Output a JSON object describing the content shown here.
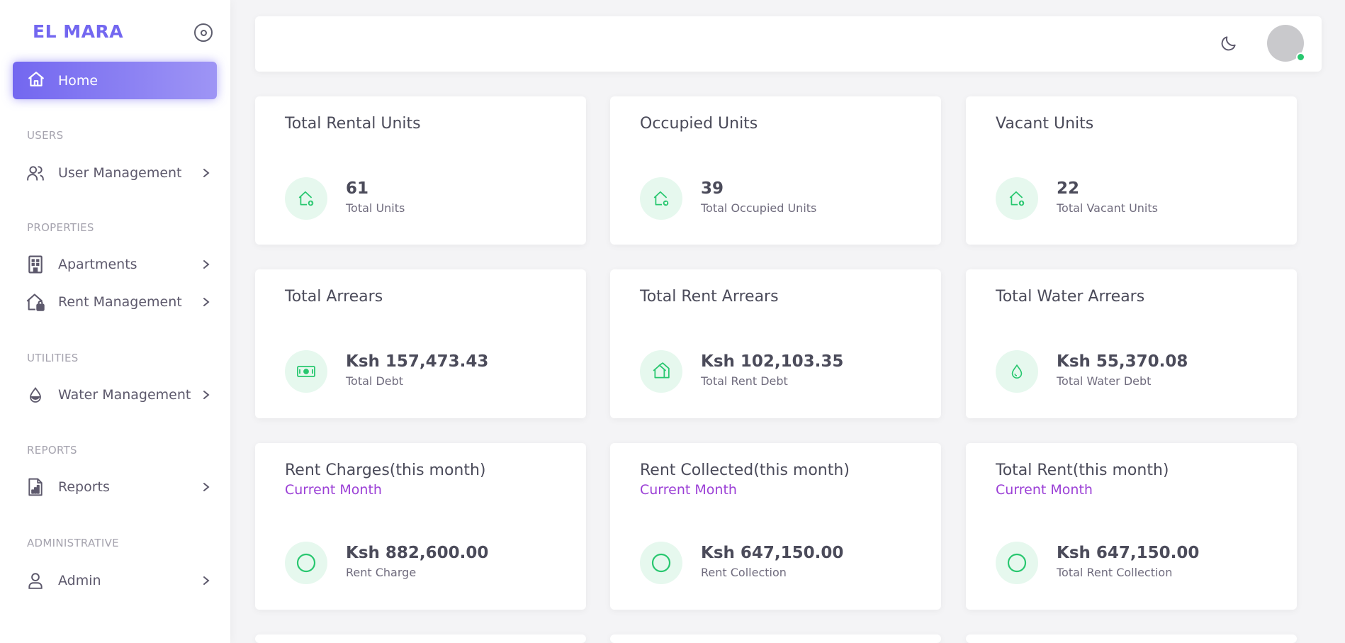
{
  "brand": {
    "name": "EL MARA",
    "color": "#7367f0"
  },
  "sidebar": {
    "home": {
      "label": "Home",
      "icon": "home-icon"
    },
    "sections": [
      {
        "label": "USERS",
        "items": [
          {
            "label": "User Management",
            "icon": "users-icon"
          }
        ]
      },
      {
        "label": "PROPERTIES",
        "items": [
          {
            "label": "Apartments",
            "icon": "building-icon"
          },
          {
            "label": "Rent Management",
            "icon": "house-lock-icon"
          }
        ]
      },
      {
        "label": "UTILITIES",
        "items": [
          {
            "label": "Water Management",
            "icon": "water-drop-icon"
          }
        ]
      },
      {
        "label": "REPORTS",
        "items": [
          {
            "label": "Reports",
            "icon": "report-file-icon"
          }
        ]
      },
      {
        "label": "ADMINISTRATIVE",
        "items": [
          {
            "label": "Admin",
            "icon": "user-icon"
          }
        ]
      }
    ]
  },
  "topbar": {
    "theme_icon": "moon-icon",
    "avatar_status_color": "#28c76f"
  },
  "cards": [
    {
      "title": "Total Rental Units",
      "value": "61",
      "caption": "Total Units",
      "icon": "house-plus-icon"
    },
    {
      "title": "Occupied Units",
      "value": "39",
      "caption": "Total Occupied Units",
      "icon": "house-check-icon"
    },
    {
      "title": "Vacant Units",
      "value": "22",
      "caption": "Total Vacant Units",
      "icon": "house-plus-icon"
    },
    {
      "title": "Total Arrears",
      "value": "Ksh 157,473.43",
      "caption": "Total Debt",
      "icon": "cash-icon"
    },
    {
      "title": "Total Rent Arrears",
      "value": "Ksh 102,103.35",
      "caption": "Total Rent Debt",
      "icon": "house-icon"
    },
    {
      "title": "Total Water Arrears",
      "value": "Ksh 55,370.08",
      "caption": "Total Water Debt",
      "icon": "water-drop-icon"
    },
    {
      "title": "Rent Charges(this month)",
      "subtitle": "Current Month",
      "value": "Ksh 882,600.00",
      "caption": "Rent Charge",
      "icon": "circle-icon"
    },
    {
      "title": "Rent Collected(this month)",
      "subtitle": "Current Month",
      "value": "Ksh 647,150.00",
      "caption": "Rent Collection",
      "icon": "circle-icon"
    },
    {
      "title": "Total Rent(this month)",
      "subtitle": "Current Month",
      "value": "Ksh 647,150.00",
      "caption": "Total Rent Collection",
      "icon": "circle-icon"
    }
  ],
  "colors": {
    "accent": "#7367f0",
    "success": "#28c76f",
    "success_bg": "#e6f8ee",
    "subtitle": "#9b3fd6"
  }
}
